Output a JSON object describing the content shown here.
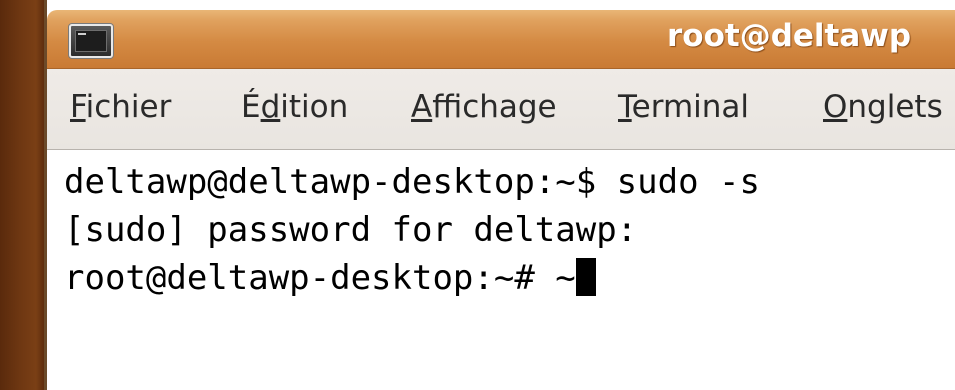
{
  "window": {
    "title": "root@deltawp",
    "icon": "terminal-icon"
  },
  "menubar": {
    "items": [
      {
        "pre": "",
        "mnemonic": "F",
        "post": "ichier"
      },
      {
        "pre": "É",
        "mnemonic": "d",
        "post": "ition"
      },
      {
        "pre": "",
        "mnemonic": "A",
        "post": "ffichage"
      },
      {
        "pre": "",
        "mnemonic": "T",
        "post": "erminal"
      },
      {
        "pre": "",
        "mnemonic": "O",
        "post": "nglets"
      }
    ]
  },
  "terminal": {
    "lines": [
      "deltawp@deltawp-desktop:~$ sudo -s",
      "[sudo] password for deltawp:",
      "root@deltawp-desktop:~# ~"
    ]
  },
  "colors": {
    "titlebar": "#d48a43",
    "desktop": "#6e3712",
    "menubar": "#ece8e4",
    "terminal_bg": "#ffffff",
    "terminal_fg": "#000000"
  }
}
